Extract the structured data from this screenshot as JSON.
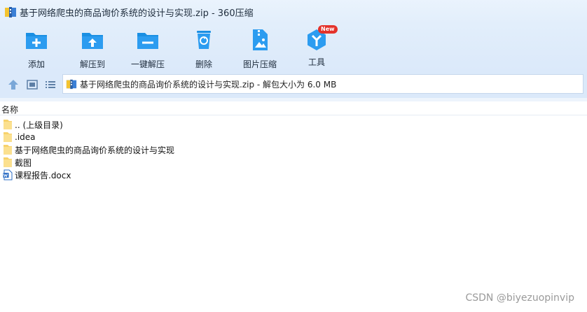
{
  "window": {
    "title": "基于网络爬虫的商品询价系统的设计与实现.zip - 360压缩",
    "icon": "archive-icon"
  },
  "toolbar": {
    "buttons": [
      {
        "label": "添加",
        "icon": "folder-add-icon"
      },
      {
        "label": "解压到",
        "icon": "folder-extract-icon"
      },
      {
        "label": "一键解压",
        "icon": "folder-one-click-icon"
      },
      {
        "label": "删除",
        "icon": "recycle-bin-icon"
      },
      {
        "label": "图片压缩",
        "icon": "image-compress-icon"
      },
      {
        "label": "工具",
        "icon": "tools-icon",
        "badge": "New"
      }
    ]
  },
  "navbar": {
    "up_icon": "arrow-up-icon",
    "view_icon": "view-thumbnail-icon",
    "list_icon": "view-list-icon",
    "address": "基于网络爬虫的商品询价系统的设计与实现.zip - 解包大小为 6.0 MB"
  },
  "columns": {
    "name": "名称"
  },
  "files": [
    {
      "name": ".. (上级目录)",
      "type": "folder"
    },
    {
      "name": ".idea",
      "type": "folder"
    },
    {
      "name": "基于网络爬虫的商品询价系统的设计与实现",
      "type": "folder"
    },
    {
      "name": "截图",
      "type": "folder"
    },
    {
      "name": "课程报告.docx",
      "type": "docx"
    }
  ],
  "watermark": "CSDN @biyezuopinvip",
  "colors": {
    "accent": "#1a8fe3",
    "toolbar_bg": "#dbe9fa",
    "folder": "#f7d26b",
    "badge": "#e4322b"
  }
}
